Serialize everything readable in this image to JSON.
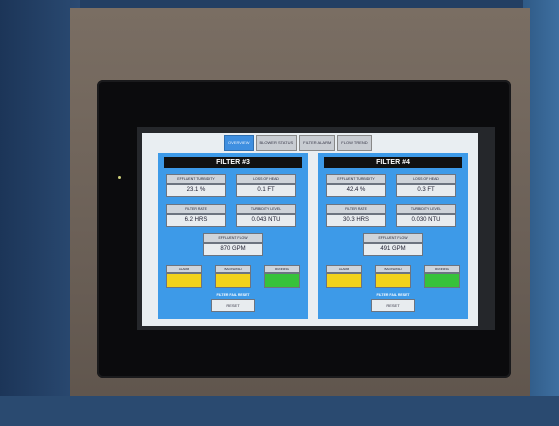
{
  "tabs": [
    {
      "label": "OVERVIEW",
      "active": true
    },
    {
      "label": "BLOWER STATUS",
      "active": false
    },
    {
      "label": "FILTER ALARM",
      "active": false
    },
    {
      "label": "FLOW TREND",
      "active": false
    }
  ],
  "filters": [
    {
      "title": "FILTER #3",
      "fields": [
        {
          "label": "EFFLUENT TURBIDITY",
          "value": "23.1 %"
        },
        {
          "label": "LOSS OF HEAD",
          "value": "0.1 FT"
        },
        {
          "label": "FILTER RATE",
          "value": "6.2 HRS"
        },
        {
          "label": "TURBIDITY LEVEL",
          "value": "0.043 NTU"
        }
      ],
      "flow": {
        "label": "EFFLUENT FLOW",
        "value": "870 GPM"
      },
      "indicators": [
        {
          "label": "ALARM",
          "color": "#f2d21a"
        },
        {
          "label": "BACKWASH",
          "color": "#f2d21a"
        },
        {
          "label": "RUNNING",
          "color": "#37c23a"
        }
      ],
      "reset": {
        "label": "FILTER FAIL RESET",
        "button": "RESET"
      }
    },
    {
      "title": "FILTER #4",
      "fields": [
        {
          "label": "EFFLUENT TURBIDITY",
          "value": "42.4 %"
        },
        {
          "label": "LOSS OF HEAD",
          "value": "0.3 FT"
        },
        {
          "label": "FILTER RATE",
          "value": "30.3 HRS"
        },
        {
          "label": "TURBIDITY LEVEL",
          "value": "0.030 NTU"
        }
      ],
      "flow": {
        "label": "EFFLUENT FLOW",
        "value": "491 GPM"
      },
      "indicators": [
        {
          "label": "ALARM",
          "color": "#f2d21a"
        },
        {
          "label": "BACKWASH",
          "color": "#f2d21a"
        },
        {
          "label": "RUNNING",
          "color": "#37c23a"
        }
      ],
      "reset": {
        "label": "FILTER FAIL RESET",
        "button": "RESET"
      }
    }
  ]
}
